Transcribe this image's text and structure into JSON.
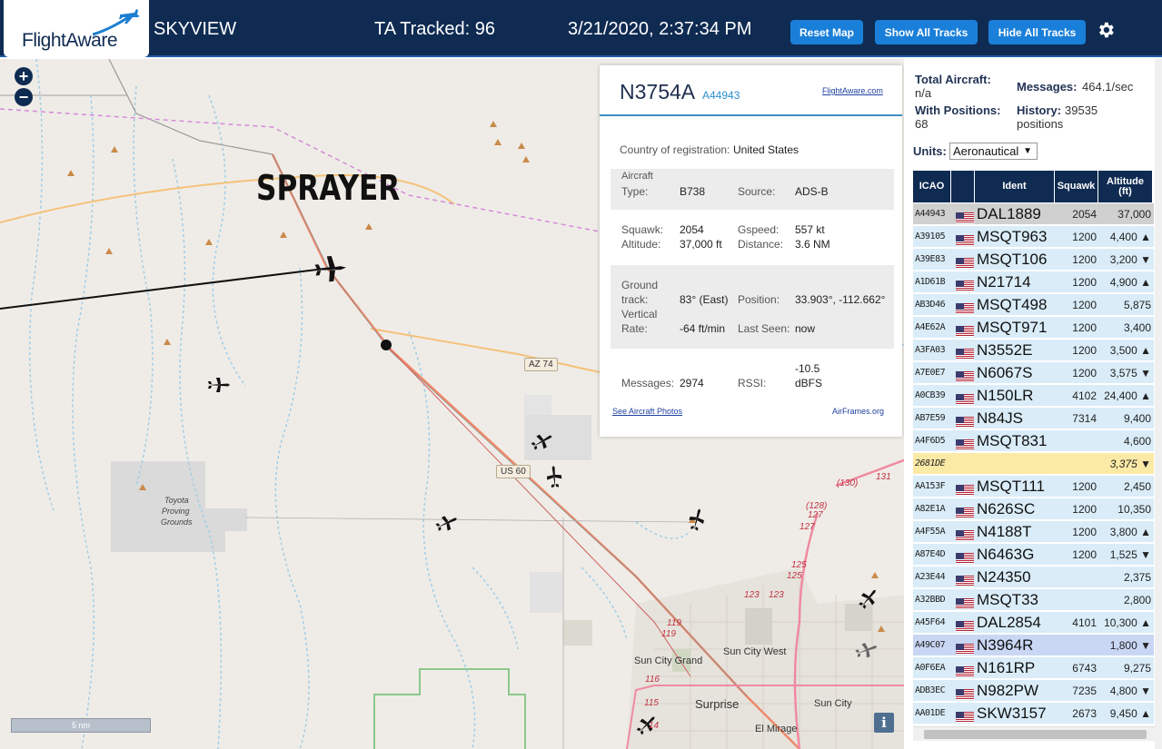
{
  "header": {
    "brand": "FlightAware",
    "app_title": "SKYVIEW",
    "ta_tracked": "TA Tracked: 96",
    "datetime": "3/21/2020, 2:37:34 PM",
    "buttons": {
      "reset": "Reset Map",
      "show_all": "Show All Tracks",
      "hide_all": "Hide All Tracks"
    },
    "settings_icon": "gear-icon"
  },
  "map": {
    "annotation": "SPRAYER",
    "zoom_in": "+",
    "zoom_out": "−",
    "scale_label": "5 nm",
    "info": "i",
    "labels": {
      "proving1": "Toyota",
      "proving2": "Proving",
      "proving3": "Grounds",
      "sun_city_grand": "Sun City Grand",
      "sun_city_west": "Sun City West",
      "surprise": "Surprise",
      "sun_city": "Sun City",
      "el_mirage": "El Mirage"
    },
    "shields": {
      "az74": "AZ 74",
      "us60": "US 60"
    },
    "route_numbers": [
      "(130)",
      "131",
      "(128)",
      "127",
      "127",
      "125",
      "125",
      "123",
      "123",
      "119",
      "119",
      "116",
      "115",
      "14"
    ]
  },
  "detail": {
    "callsign": "N3754A",
    "hex": "A44943",
    "link": "FlightAware.com",
    "country_label": "Country of registration:",
    "country_value": "United States",
    "aircraft_label1": "Aircraft",
    "type_label": "Type:",
    "type_value": "B738",
    "source_label": "Source:",
    "source_value": "ADS-B",
    "squawk_label": "Squawk:",
    "squawk_value": "2054",
    "gspeed_label": "Gspeed:",
    "gspeed_value": "557 kt",
    "altitude_label": "Altitude:",
    "altitude_value": "37,000 ft",
    "distance_label": "Distance:",
    "distance_value": "3.6 NM",
    "ground_label1": "Ground",
    "track_label": "track:",
    "track_value": "83° (East)",
    "position_label": "Position:",
    "position_value": "33.903°, -112.662°",
    "vertical_label": "Vertical",
    "rate_label": "Rate:",
    "rate_value": "-64 ft/min",
    "lastseen_label": "Last Seen:",
    "lastseen_value": "now",
    "messages_label": "Messages:",
    "messages_value": "2974",
    "rssi_label": "RSSI:",
    "rssi_value1": "-10.5",
    "rssi_value2": "dBFS",
    "photos_link": "See Aircraft Photos",
    "airframes_link": "AirFrames.org"
  },
  "sidebar": {
    "total_label": "Total Aircraft:",
    "total_value": "n/a",
    "messages_label": "Messages:",
    "messages_value": "464.1/sec",
    "positions_label": "With Positions:",
    "positions_value": "68",
    "history_label": "History:",
    "history_value": "39535",
    "history_unit": "positions",
    "units_label": "Units:",
    "units_value": "Aeronautical",
    "columns": [
      "ICAO",
      "",
      "Ident",
      "Squawk",
      "Altitude (ft)"
    ],
    "rows": [
      {
        "icao": "A44943",
        "ident": "DAL1889",
        "squawk": "2054",
        "alt": "37,000",
        "flag": true,
        "style": "selected"
      },
      {
        "icao": "A39105",
        "ident": "MSQT963",
        "squawk": "1200",
        "alt": "4,400 ▲",
        "flag": true
      },
      {
        "icao": "A39E83",
        "ident": "MSQT106",
        "squawk": "1200",
        "alt": "3,200 ▼",
        "flag": true
      },
      {
        "icao": "A1D61B",
        "ident": "N21714",
        "squawk": "1200",
        "alt": "4,900 ▲",
        "flag": true
      },
      {
        "icao": "AB3D46",
        "ident": "MSQT498",
        "squawk": "1200",
        "alt": "5,875",
        "flag": true
      },
      {
        "icao": "A4E62A",
        "ident": "MSQT971",
        "squawk": "1200",
        "alt": "3,400",
        "flag": true
      },
      {
        "icao": "A3FA03",
        "ident": "N3552E",
        "squawk": "1200",
        "alt": "3,500 ▲",
        "flag": true
      },
      {
        "icao": "A7E0E7",
        "ident": "N6067S",
        "squawk": "1200",
        "alt": "3,575 ▼",
        "flag": true
      },
      {
        "icao": "A0CB39",
        "ident": "N150LR",
        "squawk": "4102",
        "alt": "24,400 ▲",
        "flag": true
      },
      {
        "icao": "AB7E59",
        "ident": "N84JS",
        "squawk": "7314",
        "alt": "9,400",
        "flag": true
      },
      {
        "icao": "A4F6D5",
        "ident": "MSQT831",
        "squawk": "",
        "alt": "4,600",
        "flag": true
      },
      {
        "icao": "2681DE",
        "ident": "",
        "squawk": "",
        "alt": "3,375 ▼",
        "flag": false,
        "style": "mlat"
      },
      {
        "icao": "AA153F",
        "ident": "MSQT111",
        "squawk": "1200",
        "alt": "2,450",
        "flag": true
      },
      {
        "icao": "A82E1A",
        "ident": "N626SC",
        "squawk": "1200",
        "alt": "10,350",
        "flag": true
      },
      {
        "icao": "A4F55A",
        "ident": "N4188T",
        "squawk": "1200",
        "alt": "3,800 ▲",
        "flag": true
      },
      {
        "icao": "A87E4D",
        "ident": "N6463G",
        "squawk": "1200",
        "alt": "1,525 ▼",
        "flag": true
      },
      {
        "icao": "A23E44",
        "ident": "N24350",
        "squawk": "",
        "alt": "2,375",
        "flag": true
      },
      {
        "icao": "A32BBD",
        "ident": "MSQT33",
        "squawk": "",
        "alt": "2,800",
        "flag": true
      },
      {
        "icao": "A45F64",
        "ident": "DAL2854",
        "squawk": "4101",
        "alt": "10,300 ▲",
        "flag": true
      },
      {
        "icao": "A49C07",
        "ident": "N3964R",
        "squawk": "",
        "alt": "1,800 ▼",
        "flag": true,
        "style": "highlight"
      },
      {
        "icao": "A0F6EA",
        "ident": "N161RP",
        "squawk": "6743",
        "alt": "9,275",
        "flag": true
      },
      {
        "icao": "ADB3EC",
        "ident": "N982PW",
        "squawk": "7235",
        "alt": "4,800 ▼",
        "flag": true
      },
      {
        "icao": "AA01DE",
        "ident": "SKW3157",
        "squawk": "2673",
        "alt": "9,450 ▲",
        "flag": true
      }
    ]
  },
  "colors": {
    "header_bg": "#0f2b52",
    "button_blue": "#1a7fd9",
    "row_blue": "#d9ecf8",
    "row_selected": "#d0d0d0",
    "row_mlat": "#fbe9a6",
    "row_highlight": "#c9d7f5"
  }
}
